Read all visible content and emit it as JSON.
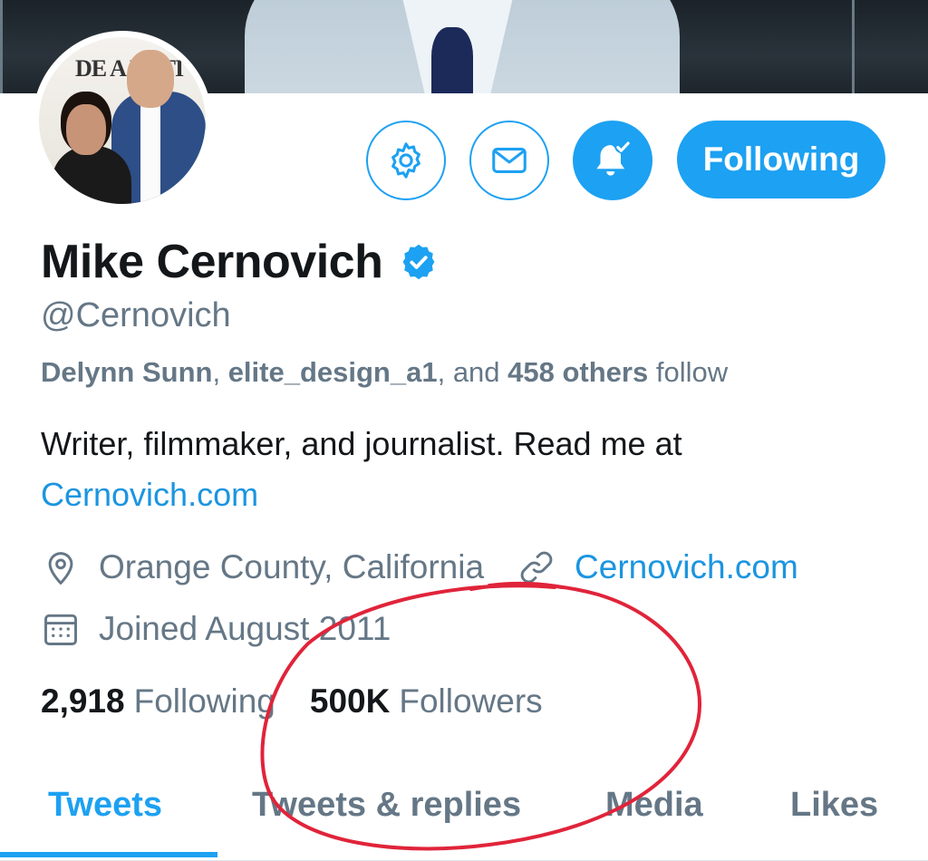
{
  "profile": {
    "name": "Mike Cernovich",
    "handle": "@Cernovich",
    "follow_context": {
      "user1": "Delynn Sunn",
      "sep1": ", ",
      "user2": "elite_design_a1",
      "sep2": ", and ",
      "others": "458 others",
      "suffix": " follow"
    },
    "bio_text": "Writer, filmmaker, and journalist. Read me at",
    "bio_link": "Cernovich.com",
    "location": "Orange County, California",
    "website": "Cernovich.com",
    "joined": "Joined August 2011",
    "following_count": "2,918",
    "following_label": "Following",
    "followers_count": "500K",
    "followers_label": "Followers"
  },
  "actions": {
    "settings_icon": "gear-icon",
    "message_icon": "envelope-icon",
    "notify_icon": "bell-check-icon",
    "following_label": "Following"
  },
  "tabs": [
    {
      "label": "Tweets",
      "active": true
    },
    {
      "label": "Tweets & replies",
      "active": false
    },
    {
      "label": "Media",
      "active": false
    },
    {
      "label": "Likes",
      "active": false
    }
  ],
  "colors": {
    "accent": "#1da1f2",
    "link": "#1b95e0",
    "secondary_text": "#657786",
    "annotation": "#e0243a"
  },
  "avatar": {
    "backdrop_text": "DE A NATI"
  }
}
